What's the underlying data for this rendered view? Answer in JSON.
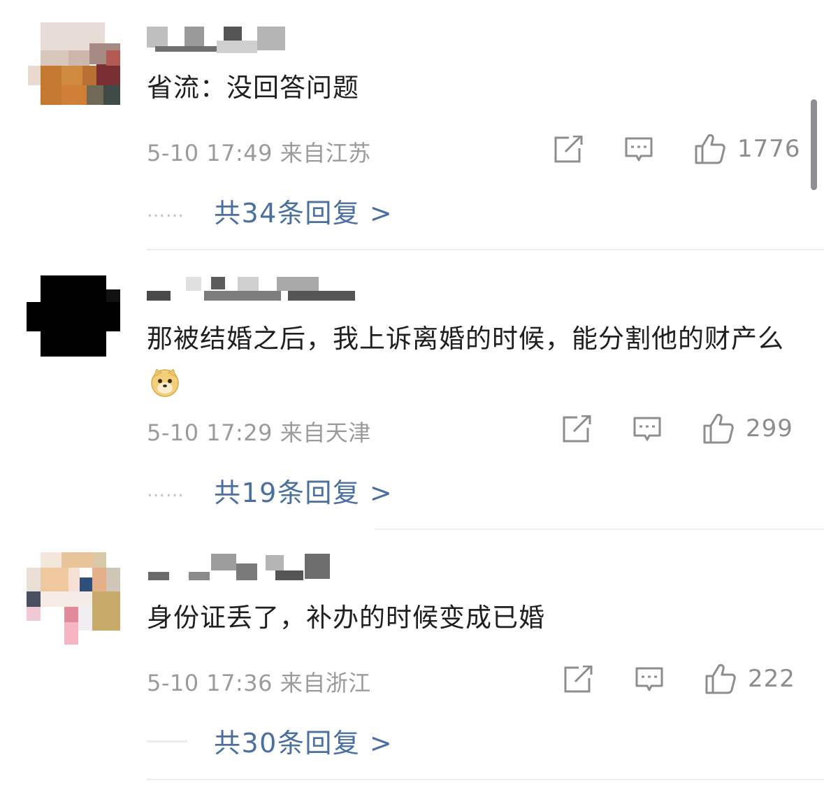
{
  "comments": [
    {
      "text": "省流：没回答问题",
      "meta": "5-10 17:49 来自江苏",
      "likes": "1776",
      "replies": "共34条回复 >"
    },
    {
      "text": "那被结婚之后，我上诉离婚的时候，能分割他的财产么",
      "meta": "5-10 17:29 来自天津",
      "likes": "299",
      "replies": "共19条回复 >"
    },
    {
      "text": "身份证丢了，补办的时候变成已婚",
      "meta": "5-10 17:36 来自浙江",
      "likes": "222",
      "replies": "共30条回复 >"
    }
  ],
  "ui": {
    "dots": "……",
    "link_color": "#4a6fa1",
    "meta_color": "#9b9b9b",
    "text_color": "#1f1f1f"
  },
  "icons": [
    "share-icon",
    "comment-icon",
    "thumbs-up-icon",
    "doge-emoji-icon"
  ]
}
